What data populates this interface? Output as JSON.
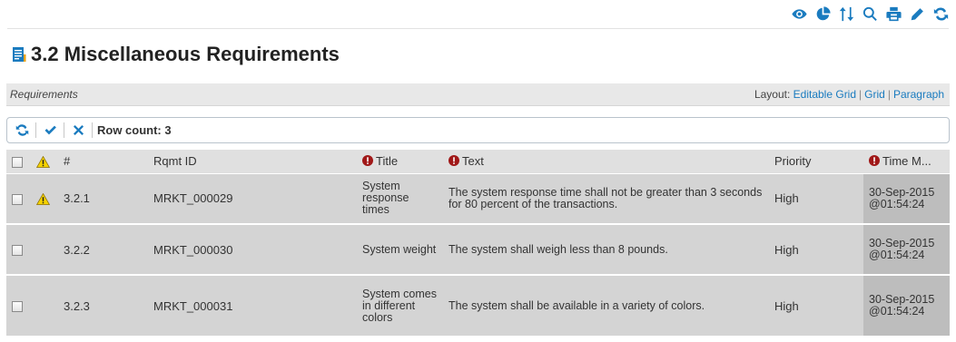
{
  "toolbar": {
    "icons": [
      "eye-icon",
      "pie-chart-icon",
      "sort-icon",
      "search-icon",
      "print-icon",
      "pencil-icon",
      "refresh-icon"
    ]
  },
  "page": {
    "title": "3.2 Miscellaneous Requirements",
    "icon": "document-icon"
  },
  "section": {
    "title": "Requirements",
    "layout_label": "Layout:",
    "layout_links": [
      "Editable Grid",
      "Grid",
      "Paragraph"
    ],
    "separator": "|"
  },
  "grid_toolbar": {
    "icons": [
      "refresh-icon",
      "check-icon",
      "close-icon"
    ],
    "row_count": "Row count: 3"
  },
  "table": {
    "columns": [
      "#",
      "Rqmt ID",
      "Title",
      "Text",
      "Priority",
      "Time M..."
    ],
    "required_columns": [
      "Title",
      "Text",
      "Time M..."
    ],
    "rows": [
      {
        "warning": true,
        "number": "3.2.1",
        "rqmt_id": "MRKT_000029",
        "title": "System response times",
        "text": "The system response time shall not be greater than 3 seconds for 80 percent of the transactions.",
        "priority": "High",
        "time": "30-Sep-2015@01:54:24"
      },
      {
        "warning": false,
        "number": "3.2.2",
        "rqmt_id": "MRKT_000030",
        "title": "System weight",
        "text": "The system shall weigh less than 8 pounds.",
        "priority": "High",
        "time": "30-Sep-2015@01:54:24"
      },
      {
        "warning": false,
        "number": "3.2.3",
        "rqmt_id": "MRKT_000031",
        "title": "System comes in different colors",
        "text": "The system shall be available in a variety of colors.",
        "priority": "High",
        "time": "30-Sep-2015@01:54:24"
      }
    ]
  },
  "colors": {
    "accent": "#1a7bbf",
    "required": "#a01818",
    "warning": "#f5d300",
    "row_bg": "#d4d4d4",
    "time_bg": "#bdbdbd"
  }
}
